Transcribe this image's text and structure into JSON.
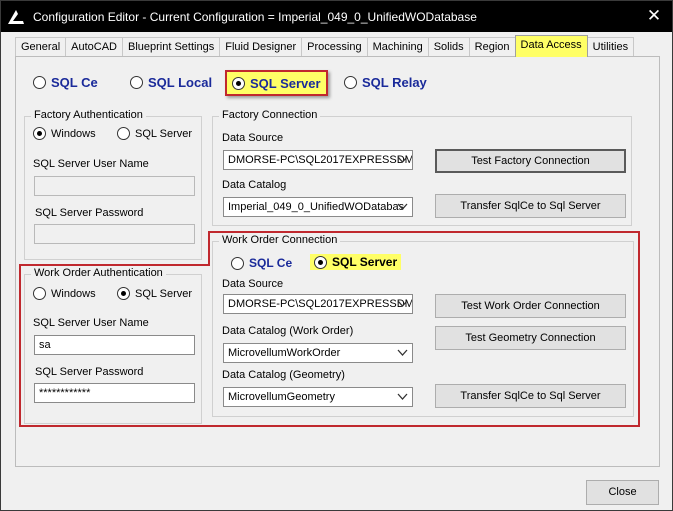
{
  "window": {
    "title": "Configuration Editor - Current Configuration = Imperial_049_0_UnifiedWODatabase"
  },
  "icons": {
    "app": "app-logo-icon",
    "close": "close-icon",
    "dropdown": "chevron-down-icon"
  },
  "colors": {
    "highlight": "#ffff66",
    "annotation": "#c0282e",
    "radio_text": "#1a2a9a"
  },
  "tabs": [
    {
      "label": "General"
    },
    {
      "label": "AutoCAD"
    },
    {
      "label": "Blueprint Settings"
    },
    {
      "label": "Fluid Designer"
    },
    {
      "label": "Processing"
    },
    {
      "label": "Machining"
    },
    {
      "label": "Solids"
    },
    {
      "label": "Region"
    },
    {
      "label": "Data Access",
      "active": true
    },
    {
      "label": "Utilities"
    }
  ],
  "db_type": {
    "options": [
      "SQL Ce",
      "SQL Local",
      "SQL Server",
      "SQL Relay"
    ],
    "selected": "SQL Server"
  },
  "factory_auth": {
    "legend": "Factory Authentication",
    "windows": "Windows",
    "sql_server": "SQL Server",
    "selected": "Windows",
    "user_label": "SQL Server User Name",
    "user_value": "",
    "password_label": "SQL Server Password",
    "password_value": ""
  },
  "factory_conn": {
    "legend": "Factory Connection",
    "source_label": "Data Source",
    "source_value": "DMORSE-PC\\SQL2017EXPRESSDM",
    "catalog_label": "Data Catalog",
    "catalog_value": "Imperial_049_0_UnifiedWODatabas",
    "test_button": "Test Factory Connection",
    "transfer_button": "Transfer SqlCe to Sql Server"
  },
  "wo_auth": {
    "legend": "Work Order Authentication",
    "windows": "Windows",
    "sql_server": "SQL Server",
    "selected": "SQL Server",
    "user_label": "SQL Server User Name",
    "user_value": "sa",
    "password_label": "SQL Server Password",
    "password_value": "************"
  },
  "wo_conn": {
    "legend": "Work Order Connection",
    "sqlce": "SQL Ce",
    "sqlserver": "SQL Server",
    "selected": "SQL Server",
    "source_label": "Data Source",
    "source_value": "DMORSE-PC\\SQL2017EXPRESSDM",
    "catalog_wo_label": "Data Catalog (Work Order)",
    "catalog_wo_value": "MicrovellumWorkOrder",
    "catalog_geo_label": "Data Catalog (Geometry)",
    "catalog_geo_value": "MicrovellumGeometry",
    "test_wo_button": "Test Work Order Connection",
    "test_geo_button": "Test Geometry Connection",
    "transfer_button": "Transfer SqlCe to Sql Server"
  },
  "footer": {
    "close_button": "Close"
  }
}
